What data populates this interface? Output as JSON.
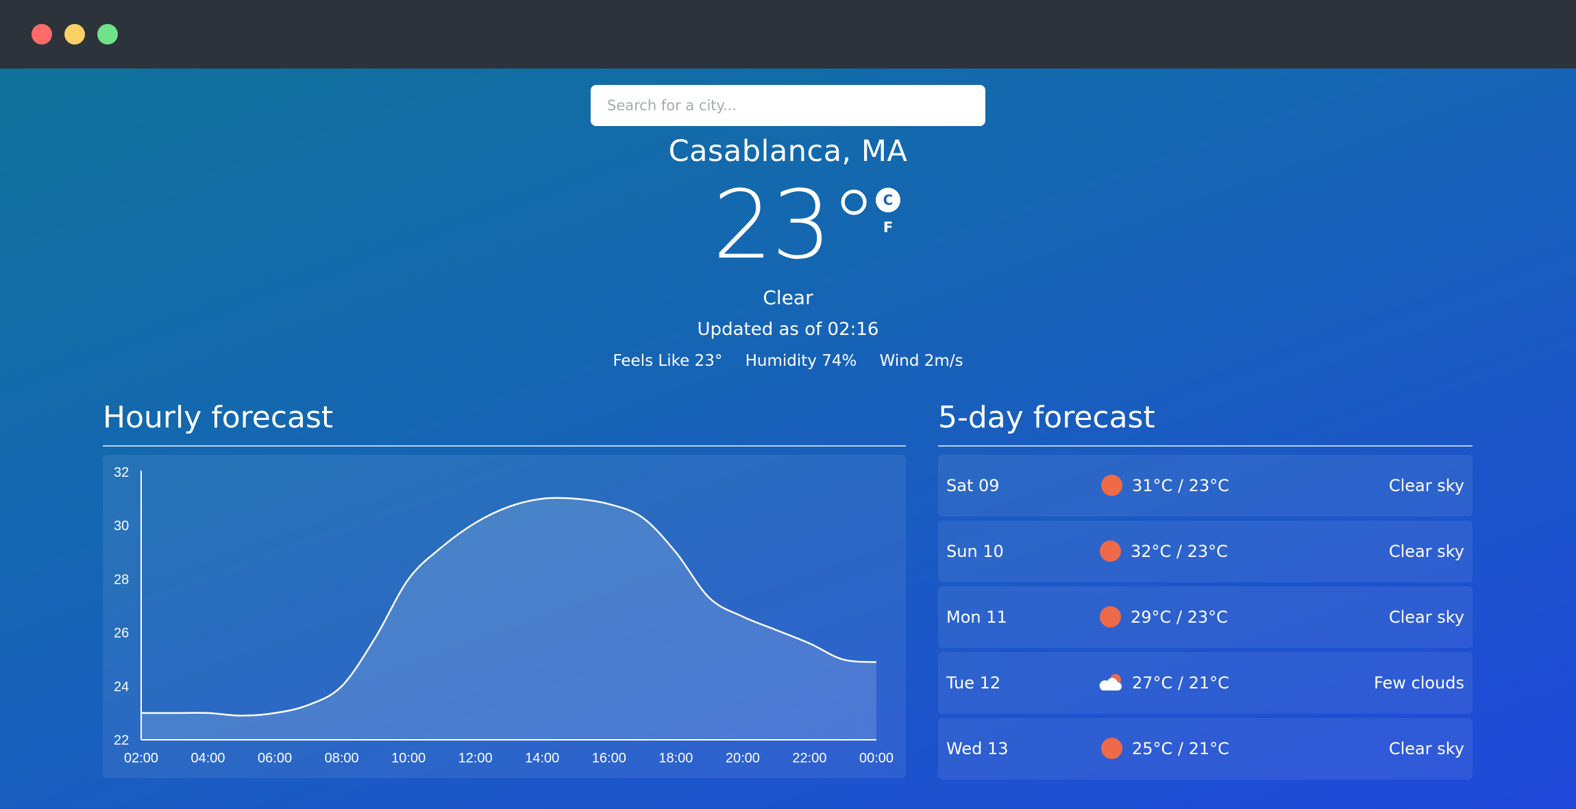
{
  "window": {
    "controls": [
      {
        "name": "close",
        "color": "#ff6b6b"
      },
      {
        "name": "minimize",
        "color": "#fdd065"
      },
      {
        "name": "maximize",
        "color": "#6fe38a"
      }
    ]
  },
  "search": {
    "placeholder": "Search for a city..."
  },
  "current": {
    "city": "Casablanca, MA",
    "temperature": "23°",
    "unit_c": "C",
    "unit_f": "F",
    "condition": "Clear",
    "updated": "Updated as of 02:16",
    "feels_like": "Feels Like 23°",
    "humidity": "Humidity 74%",
    "wind": "Wind 2m/s"
  },
  "hourly": {
    "title": "Hourly forecast"
  },
  "daily": {
    "title": "5-day forecast",
    "days": [
      {
        "day": "Sat 09",
        "range": "31°C / 23°C",
        "desc": "Clear sky",
        "icon": "sun-icon"
      },
      {
        "day": "Sun 10",
        "range": "32°C / 23°C",
        "desc": "Clear sky",
        "icon": "sun-icon"
      },
      {
        "day": "Mon 11",
        "range": "29°C / 23°C",
        "desc": "Clear sky",
        "icon": "sun-icon"
      },
      {
        "day": "Tue 12",
        "range": "27°C / 21°C",
        "desc": "Few clouds",
        "icon": "cloud-sun-icon"
      },
      {
        "day": "Wed 13",
        "range": "25°C / 21°C",
        "desc": "Clear sky",
        "icon": "sun-icon"
      }
    ]
  },
  "chart_data": {
    "type": "area",
    "x": [
      "02:00",
      "03:00",
      "04:00",
      "05:00",
      "06:00",
      "07:00",
      "08:00",
      "09:00",
      "10:00",
      "11:00",
      "12:00",
      "13:00",
      "14:00",
      "15:00",
      "16:00",
      "17:00",
      "18:00",
      "19:00",
      "20:00",
      "21:00",
      "22:00",
      "23:00",
      "00:00"
    ],
    "series": [
      {
        "values": [
          23.0,
          23.0,
          23.0,
          22.9,
          23.0,
          23.3,
          24.0,
          25.8,
          28.0,
          29.2,
          30.1,
          30.7,
          31.0,
          31.0,
          30.8,
          30.3,
          29.0,
          27.3,
          26.6,
          26.1,
          25.6,
          25.0,
          24.9
        ]
      }
    ],
    "x_ticks": [
      "02:00",
      "04:00",
      "06:00",
      "08:00",
      "10:00",
      "12:00",
      "14:00",
      "16:00",
      "18:00",
      "20:00",
      "22:00",
      "00:00"
    ],
    "y_ticks": [
      22,
      24,
      26,
      28,
      30,
      32
    ],
    "ylim": [
      22,
      32
    ],
    "colors": {
      "line": "#ffffff",
      "fill": "rgba(255,255,255,0.15)"
    }
  }
}
